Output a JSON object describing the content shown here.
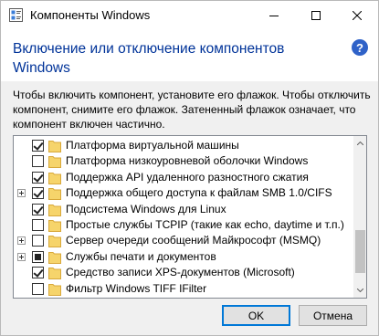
{
  "window": {
    "title": "Компоненты Windows"
  },
  "header": {
    "heading": "Включение или отключение компонентов Windows",
    "help_symbol": "?"
  },
  "description": "Чтобы включить компонент, установите его флажок. Чтобы отключить компонент, снимите его флажок. Затененный флажок означает, что компонент включен частично.",
  "features": [
    {
      "label": "Платформа виртуальной машины",
      "state": "checked",
      "expandable": false
    },
    {
      "label": "Платформа низкоуровневой оболочки Windows",
      "state": "unchecked",
      "expandable": false
    },
    {
      "label": "Поддержка API удаленного разностного сжатия",
      "state": "checked",
      "expandable": false
    },
    {
      "label": "Поддержка общего доступа к файлам SMB 1.0/CIFS",
      "state": "checked",
      "expandable": true
    },
    {
      "label": "Подсистема Windows для Linux",
      "state": "checked",
      "expandable": false
    },
    {
      "label": "Простые службы TCPIP (такие как echo, daytime и т.п.)",
      "state": "unchecked",
      "expandable": false
    },
    {
      "label": "Сервер очереди сообщений Майкрософт (MSMQ)",
      "state": "unchecked",
      "expandable": true
    },
    {
      "label": "Службы печати и документов",
      "state": "partial",
      "expandable": true
    },
    {
      "label": "Средство записи XPS-документов (Microsoft)",
      "state": "checked",
      "expandable": false
    },
    {
      "label": "Фильтр Windows TIFF IFilter",
      "state": "unchecked",
      "expandable": false
    }
  ],
  "buttons": {
    "ok": "OK",
    "cancel": "Отмена"
  },
  "colors": {
    "heading": "#003399",
    "folder": "#f6d46b",
    "accent": "#0078d7"
  }
}
